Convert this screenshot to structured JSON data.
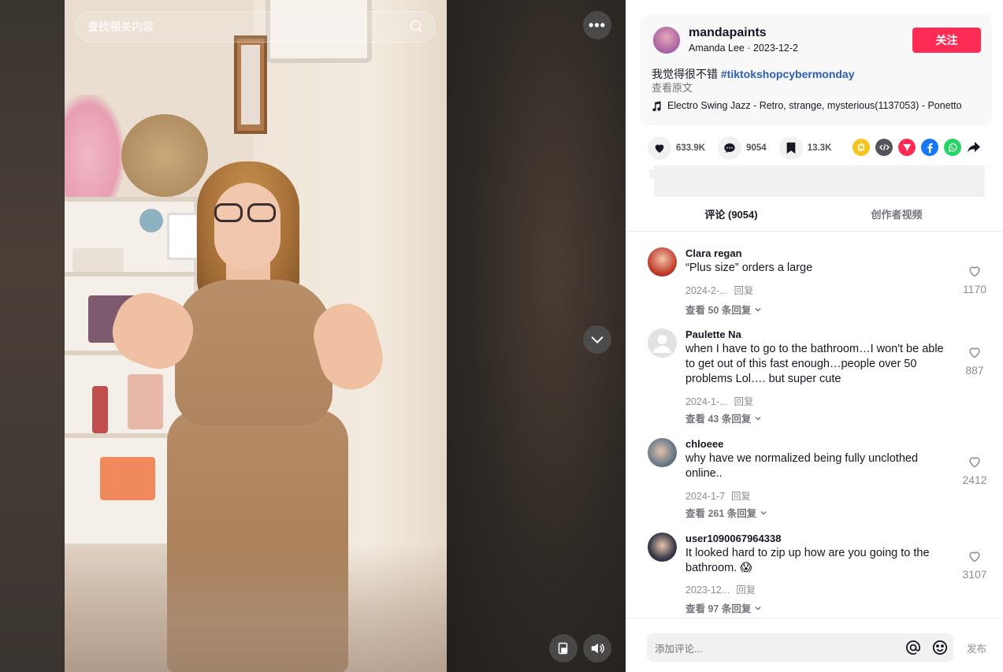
{
  "search": {
    "placeholder": "查找相关内容"
  },
  "video_controls": {
    "more_label": "•••",
    "icons": [
      "search-icon",
      "more-icon",
      "chevron-down-icon",
      "mini-player-icon",
      "volume-icon"
    ]
  },
  "author": {
    "handle": "mandapaints",
    "name": "Amanda Lee",
    "separator": " · ",
    "date": "2023-12-2",
    "follow_label": "关注"
  },
  "post": {
    "caption_text": "我觉得很不错 ",
    "caption_tag": "#tiktokshopcybermonday",
    "see_original": "查看原文",
    "music": "Electro Swing Jazz - Retro, strange, mysterious(1137053) - Ponetto"
  },
  "actions": {
    "likes": "633.9K",
    "comments": "9054",
    "saves": "13.3K"
  },
  "share": {
    "icons": [
      "repost-icon",
      "embed-icon",
      "send-icon",
      "facebook-icon",
      "whatsapp-icon",
      "share-arrow-icon"
    ],
    "colors": {
      "repost": "#f9c31f",
      "embed": "#53545c",
      "send": "#fe2c55",
      "facebook": "#1877f2",
      "whatsapp": "#25d366"
    }
  },
  "tabs": [
    {
      "label": "评论 (9054)",
      "active": true
    },
    {
      "label": "创作者视频",
      "active": false
    }
  ],
  "comments": [
    {
      "user": "Clara regan",
      "text": "“Plus size” orders a large",
      "date": "2024-2-...",
      "reply_label": "回复",
      "replies": "查看 50 条回复",
      "likes": "1170"
    },
    {
      "user": "Paulette Na",
      "text": "when I have to go to the bathroom…I won't be able to get out of this fast enough…people over 50 problems Lol…. but super cute",
      "date": "2024-1-...",
      "reply_label": "回复",
      "replies": "查看 43 条回复",
      "likes": "887"
    },
    {
      "user": "chloeee",
      "text": "why have we normalized being fully unclothed online..",
      "date": "2024-1-7",
      "reply_label": "回复",
      "replies": "查看 261 条回复",
      "likes": "2412"
    },
    {
      "user": "user1090067964338",
      "text": "It looked hard to zip up how are you going to the bathroom. 😱",
      "date": "2023-12...",
      "reply_label": "回复",
      "replies": "查看 97 条回复",
      "likes": "3107"
    }
  ],
  "composer": {
    "placeholder": "添加评论...",
    "post_label": "发布"
  },
  "colors": {
    "accent": "#fe2c55",
    "hashtag": "#2b5db9",
    "text": "#161823"
  }
}
